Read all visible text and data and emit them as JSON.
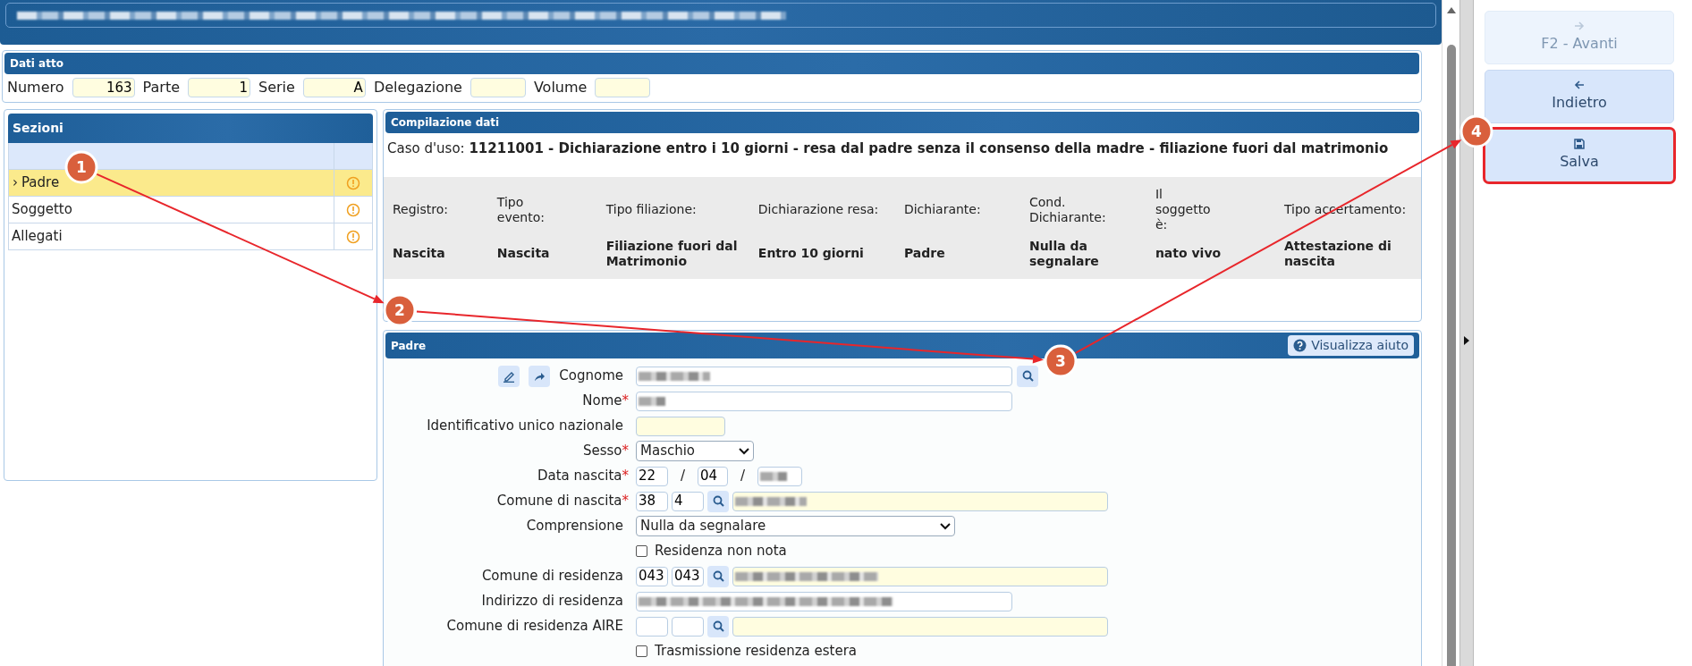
{
  "dati_atto": {
    "title": "Dati atto",
    "fields": [
      {
        "label": "Numero",
        "value": "163"
      },
      {
        "label": "Parte",
        "value": "1"
      },
      {
        "label": "Serie",
        "value": "A"
      },
      {
        "label": "Delegazione"
      },
      {
        "label": "Volume"
      }
    ]
  },
  "sezioni": {
    "title": "Sezioni",
    "items": [
      {
        "label": "Padre",
        "selected": true,
        "marker": "›"
      },
      {
        "label": "Soggetto",
        "selected": false
      },
      {
        "label": "Allegati",
        "selected": false
      }
    ]
  },
  "compilazione": {
    "title": "Compilazione dati",
    "caso_label": "Caso d'uso:",
    "caso_value": "11211001 - Dichiarazione entro i 10 giorni - resa dal padre senza il consenso della madre - filiazione fuori dal matrimonio",
    "columns": [
      {
        "label": "Registro:",
        "value": "Nascita"
      },
      {
        "label": "Tipo evento:",
        "value": "Nascita"
      },
      {
        "label": "Tipo filiazione:",
        "value": "Filiazione fuori dal Matrimonio"
      },
      {
        "label": "Dichiarazione resa:",
        "value": "Entro 10 giorni"
      },
      {
        "label": "Dichiarante:",
        "value": "Padre"
      },
      {
        "label": "Cond. Dichiarante:",
        "value": "Nulla da segnalare"
      },
      {
        "label": "Il soggetto è:",
        "value": "nato vivo"
      },
      {
        "label": "Tipo accertamento:",
        "value": "Attestazione di nascita"
      }
    ]
  },
  "padre": {
    "title": "Padre",
    "help_button": "Visualizza aiuto",
    "rows": [
      {
        "kind": "lookup-text",
        "label": "Cognome",
        "redacted": true
      },
      {
        "kind": "text",
        "label": "Nome",
        "required_mark": "*",
        "redacted": true
      },
      {
        "kind": "short",
        "label": "Identificativo unico nazionale"
      },
      {
        "kind": "select",
        "label": "Sesso",
        "required_mark": "*",
        "value": "Maschio"
      },
      {
        "kind": "date",
        "label": "Data nascita",
        "required_mark": "*",
        "day": "22",
        "month": "04",
        "separators": [
          "/",
          "/"
        ],
        "year_redacted": true
      },
      {
        "kind": "comune",
        "label": "Comune di nascita",
        "required_mark": "*",
        "code1": "38",
        "code2": "4",
        "name_redacted": true
      },
      {
        "kind": "wide-select",
        "label": "Comprensione",
        "value": "Nulla da segnalare"
      },
      {
        "kind": "checkbox",
        "label": "Residenza non nota",
        "checked": false
      },
      {
        "kind": "comune",
        "label": "Comune di residenza",
        "code1": "043",
        "code2": "043",
        "name_redacted": true
      },
      {
        "kind": "text",
        "label": "Indirizzo di residenza",
        "redacted": true
      },
      {
        "kind": "comune",
        "label": "Comune di residenza AIRE",
        "name_redacted": false
      },
      {
        "kind": "checkbox",
        "label": "Trasmissione residenza estera",
        "checked": false
      }
    ]
  },
  "actions": [
    {
      "kind": "forward",
      "label": "F2 - Avanti",
      "disabled": true,
      "highlighted": false
    },
    {
      "kind": "back",
      "label": "Indietro",
      "disabled": false,
      "highlighted": false
    },
    {
      "kind": "save",
      "label": "Salva",
      "disabled": false,
      "highlighted": true
    }
  ],
  "annotations": [
    {
      "number": "1"
    },
    {
      "number": "2"
    },
    {
      "number": "3"
    },
    {
      "number": "4"
    }
  ]
}
